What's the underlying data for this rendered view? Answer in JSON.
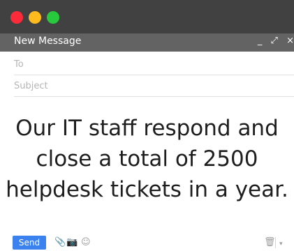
{
  "window": {
    "controls": [
      "close",
      "minimize",
      "maximize"
    ]
  },
  "compose": {
    "title": "New Message",
    "header_icons": {
      "minimize": "_",
      "expand": "⤢",
      "close": "×"
    }
  },
  "fields": {
    "to_placeholder": "To",
    "subject_placeholder": "Subject"
  },
  "body": {
    "lines": [
      "Our IT staff respond and",
      "close a total of 2500",
      "helpdesk tickets in a year."
    ]
  },
  "toolbar": {
    "send_label": "Send",
    "icons": {
      "attach": "📎",
      "camera": "📷",
      "emoji": "☺",
      "trash": "🗑",
      "more": "▾"
    }
  },
  "colors": {
    "titlebar": "#414141",
    "compose_header": "#636363",
    "send_button": "#3b82ee",
    "dot_red": "#fc2b3a",
    "dot_yellow": "#fdbb1e",
    "dot_green": "#29c93d"
  }
}
